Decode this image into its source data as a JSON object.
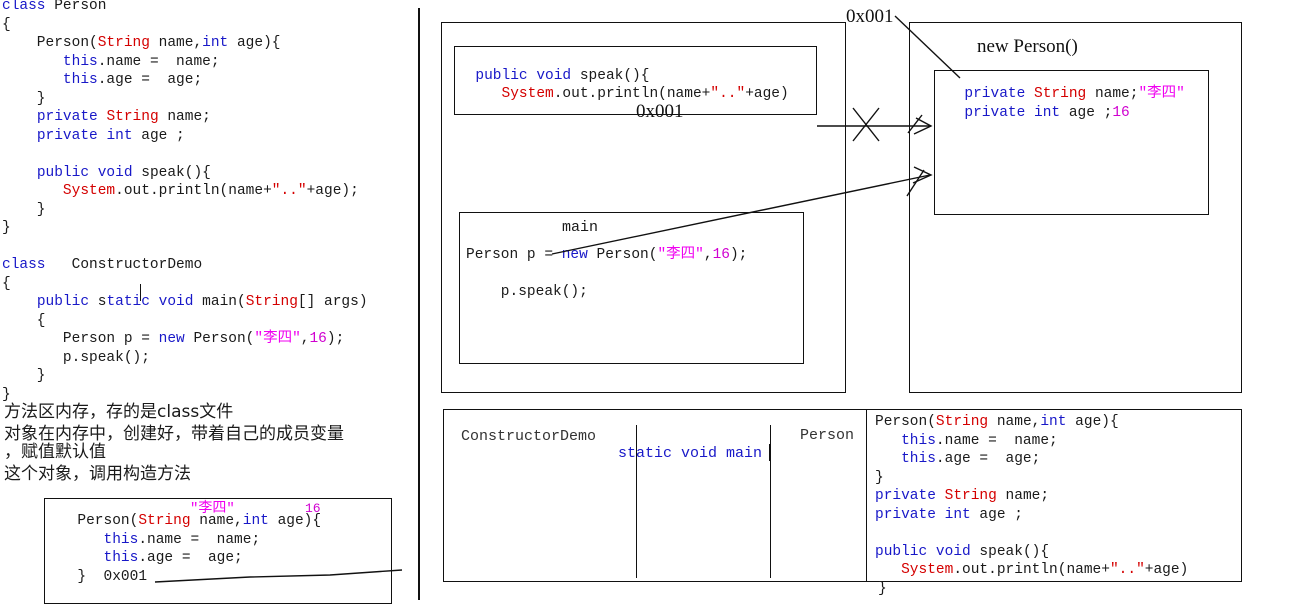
{
  "left_panel": {
    "name": "source-code-editor",
    "code_lines": [
      [
        {
          "t": "class ",
          "c": "kw"
        },
        {
          "t": "Person",
          "c": "plain"
        }
      ],
      [
        {
          "t": "{",
          "c": "plain"
        }
      ],
      [
        {
          "t": "    Person(",
          "c": "plain"
        },
        {
          "t": "String",
          "c": "ty"
        },
        {
          "t": " name,",
          "c": "plain"
        },
        {
          "t": "int",
          "c": "kw"
        },
        {
          "t": " age){",
          "c": "plain"
        }
      ],
      [
        {
          "t": "       ",
          "c": "plain"
        },
        {
          "t": "this",
          "c": "kw"
        },
        {
          "t": ".name =  name;",
          "c": "plain"
        }
      ],
      [
        {
          "t": "       ",
          "c": "plain"
        },
        {
          "t": "this",
          "c": "kw"
        },
        {
          "t": ".age =  age;",
          "c": "plain"
        }
      ],
      [
        {
          "t": "    }",
          "c": "plain"
        }
      ],
      [
        {
          "t": "    ",
          "c": "plain"
        },
        {
          "t": "private",
          "c": "kw"
        },
        {
          "t": " ",
          "c": "plain"
        },
        {
          "t": "String",
          "c": "ty"
        },
        {
          "t": " name;",
          "c": "plain"
        }
      ],
      [
        {
          "t": "    ",
          "c": "plain"
        },
        {
          "t": "private",
          "c": "kw"
        },
        {
          "t": " ",
          "c": "plain"
        },
        {
          "t": "int",
          "c": "kw"
        },
        {
          "t": " age ;",
          "c": "plain"
        }
      ],
      [
        {
          "t": "",
          "c": "plain"
        }
      ],
      [
        {
          "t": "    ",
          "c": "plain"
        },
        {
          "t": "public",
          "c": "kw"
        },
        {
          "t": " ",
          "c": "plain"
        },
        {
          "t": "void",
          "c": "kw"
        },
        {
          "t": " speak(){",
          "c": "plain"
        }
      ],
      [
        {
          "t": "       ",
          "c": "plain"
        },
        {
          "t": "System",
          "c": "ty"
        },
        {
          "t": ".out.println(name+",
          "c": "plain"
        },
        {
          "t": "\"..\"",
          "c": "ty"
        },
        {
          "t": "+age);",
          "c": "plain"
        }
      ],
      [
        {
          "t": "    }",
          "c": "plain"
        }
      ],
      [
        {
          "t": "}",
          "c": "plain"
        }
      ],
      [
        {
          "t": "",
          "c": "plain"
        }
      ],
      [
        {
          "t": "class ",
          "c": "kw"
        },
        {
          "t": "  ConstructorDemo",
          "c": "plain"
        }
      ],
      [
        {
          "t": "{",
          "c": "plain"
        }
      ],
      [
        {
          "t": "    ",
          "c": "plain"
        },
        {
          "t": "public",
          "c": "kw"
        },
        {
          "t": " s",
          "c": "plain"
        },
        {
          "t": "tatic",
          "c": "kw"
        },
        {
          "t": " ",
          "c": "plain"
        },
        {
          "t": "void",
          "c": "kw"
        },
        {
          "t": " main(",
          "c": "plain"
        },
        {
          "t": "String",
          "c": "ty"
        },
        {
          "t": "[] args)",
          "c": "plain"
        }
      ],
      [
        {
          "t": "    {",
          "c": "plain"
        }
      ],
      [
        {
          "t": "       Person p = ",
          "c": "plain"
        },
        {
          "t": "new",
          "c": "kw"
        },
        {
          "t": " Person(",
          "c": "plain"
        },
        {
          "t": "\"李四\"",
          "c": "str"
        },
        {
          "t": ",",
          "c": "plain"
        },
        {
          "t": "16",
          "c": "num"
        },
        {
          "t": ");",
          "c": "plain"
        }
      ],
      [
        {
          "t": "       p.speak();",
          "c": "plain"
        }
      ],
      [
        {
          "t": "    }",
          "c": "plain"
        }
      ],
      [
        {
          "t": "}",
          "c": "plain"
        }
      ]
    ],
    "notes": [
      "方法区内存，存的是class文件",
      "对象在内存中，创建好，带着自己的成员变量",
      "，赋值默认值",
      "这个对象，调用构造方法"
    ],
    "constructor_box": {
      "arg_name_value": "\"李四\"",
      "arg_age_value": "16",
      "lines": [
        [
          {
            "t": "  Person(",
            "c": "plain"
          },
          {
            "t": "String",
            "c": "ty"
          },
          {
            "t": " name,",
            "c": "plain"
          },
          {
            "t": "int",
            "c": "kw"
          },
          {
            "t": " age){",
            "c": "plain"
          }
        ],
        [
          {
            "t": "     ",
            "c": "plain"
          },
          {
            "t": "this",
            "c": "kw"
          },
          {
            "t": ".name =  name;",
            "c": "plain"
          }
        ],
        [
          {
            "t": "     ",
            "c": "plain"
          },
          {
            "t": "this",
            "c": "kw"
          },
          {
            "t": ".age =  age;",
            "c": "plain"
          }
        ],
        [
          {
            "t": "  }  0x001",
            "c": "plain"
          }
        ]
      ],
      "address_label": "0x001"
    }
  },
  "heap_panel": {
    "name": "method-area-panel",
    "speak_box": {
      "lines": [
        [
          {
            "t": "",
            "c": "plain"
          }
        ],
        [
          {
            "t": "  ",
            "c": "plain"
          },
          {
            "t": "public",
            "c": "kw"
          },
          {
            "t": " ",
            "c": "plain"
          },
          {
            "t": "void",
            "c": "kw"
          },
          {
            "t": " speak(){",
            "c": "plain"
          }
        ],
        [
          {
            "t": "     ",
            "c": "plain"
          },
          {
            "t": "System",
            "c": "ty"
          },
          {
            "t": ".out.println(name+",
            "c": "plain"
          },
          {
            "t": "\"..\"",
            "c": "ty"
          },
          {
            "t": "+age)",
            "c": "plain"
          }
        ]
      ],
      "address_label": "0x001"
    },
    "main_box": {
      "title": "main",
      "lines": [
        [
          {
            "t": "Person p = ",
            "c": "plain"
          },
          {
            "t": "new",
            "c": "kw"
          },
          {
            "t": " Person(",
            "c": "plain"
          },
          {
            "t": "\"李四\"",
            "c": "str"
          },
          {
            "t": ",",
            "c": "plain"
          },
          {
            "t": "16",
            "c": "num"
          },
          {
            "t": ");",
            "c": "plain"
          }
        ],
        [
          {
            "t": "",
            "c": "plain"
          }
        ],
        [
          {
            "t": "    p.speak();",
            "c": "plain"
          }
        ]
      ]
    }
  },
  "object_panel": {
    "name": "heap-object-panel",
    "address_label": "0x001",
    "title": "new Person()",
    "fields": [
      [
        {
          "t": "  ",
          "c": "plain"
        },
        {
          "t": "private",
          "c": "kw"
        },
        {
          "t": " ",
          "c": "plain"
        },
        {
          "t": "String",
          "c": "ty"
        },
        {
          "t": " name;",
          "c": "plain"
        },
        {
          "t": "\"李四\"",
          "c": "str"
        }
      ],
      [
        {
          "t": "  ",
          "c": "plain"
        },
        {
          "t": "private",
          "c": "kw"
        },
        {
          "t": " ",
          "c": "plain"
        },
        {
          "t": "int",
          "c": "kw"
        },
        {
          "t": " age ;",
          "c": "plain"
        },
        {
          "t": "16",
          "c": "num"
        }
      ]
    ]
  },
  "bottom_panel": {
    "name": "stack-frame-panel",
    "col1_label": "ConstructorDemo",
    "col2_label": "static void main",
    "col3_label": "Person",
    "class_code_lines": [
      [
        {
          "t": "Person(",
          "c": "plain"
        },
        {
          "t": "String",
          "c": "ty"
        },
        {
          "t": " name,",
          "c": "plain"
        },
        {
          "t": "int",
          "c": "kw"
        },
        {
          "t": " age){",
          "c": "plain"
        }
      ],
      [
        {
          "t": "   ",
          "c": "plain"
        },
        {
          "t": "this",
          "c": "kw"
        },
        {
          "t": ".name =  name;",
          "c": "plain"
        }
      ],
      [
        {
          "t": "   ",
          "c": "plain"
        },
        {
          "t": "this",
          "c": "kw"
        },
        {
          "t": ".age =  age;",
          "c": "plain"
        }
      ],
      [
        {
          "t": "}",
          "c": "plain"
        }
      ],
      [
        {
          "t": "",
          "c": "plain"
        },
        {
          "t": "private",
          "c": "kw"
        },
        {
          "t": " ",
          "c": "plain"
        },
        {
          "t": "String",
          "c": "ty"
        },
        {
          "t": " name;",
          "c": "plain"
        }
      ],
      [
        {
          "t": "",
          "c": "plain"
        },
        {
          "t": "private",
          "c": "kw"
        },
        {
          "t": " ",
          "c": "plain"
        },
        {
          "t": "int",
          "c": "kw"
        },
        {
          "t": " age ;",
          "c": "plain"
        }
      ],
      [
        {
          "t": "",
          "c": "plain"
        }
      ],
      [
        {
          "t": "",
          "c": "plain"
        },
        {
          "t": "public",
          "c": "kw"
        },
        {
          "t": " ",
          "c": "plain"
        },
        {
          "t": "void",
          "c": "kw"
        },
        {
          "t": " speak(){",
          "c": "plain"
        }
      ],
      [
        {
          "t": "   ",
          "c": "plain"
        },
        {
          "t": "System",
          "c": "ty"
        },
        {
          "t": ".out.println(name+",
          "c": "plain"
        },
        {
          "t": "\"..\"",
          "c": "ty"
        },
        {
          "t": "+age)",
          "c": "plain"
        }
      ]
    ],
    "trailing_brace": "}"
  },
  "colors": {
    "keyword": "#1818c8",
    "type": "#d40000",
    "string": "#f000f0",
    "number": "#d000d0",
    "text": "#1a1a1a",
    "stroke": "#111111",
    "background": "#ffffff"
  }
}
